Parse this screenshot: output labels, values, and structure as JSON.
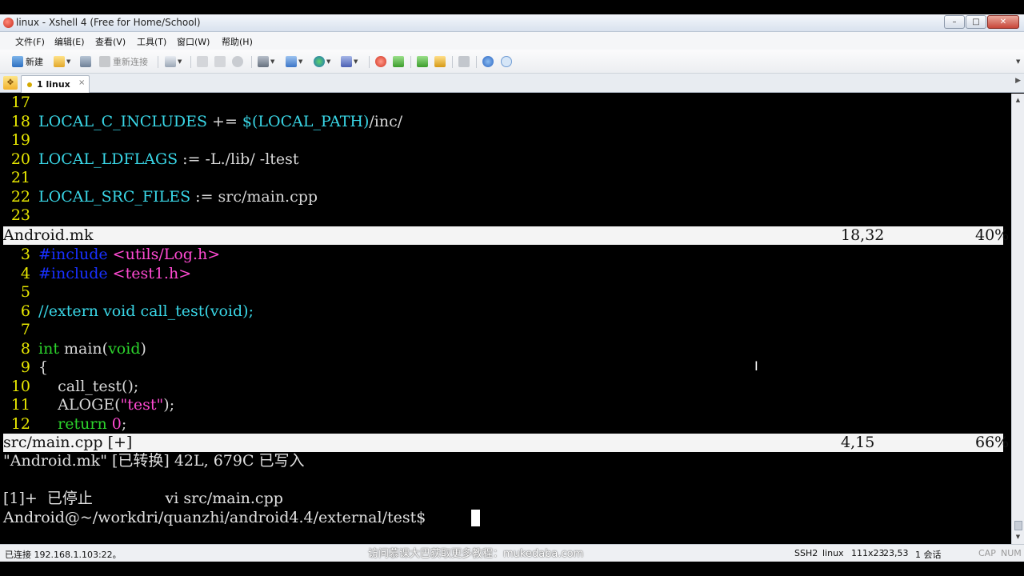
{
  "window": {
    "title": "linux - Xshell 4 (Free for Home/School)",
    "buttons": {
      "minimize": "–",
      "maximize": "□",
      "close": "✕"
    }
  },
  "menu": [
    "文件(F)",
    "编辑(E)",
    "查看(V)",
    "工具(T)",
    "窗口(W)",
    "帮助(H)"
  ],
  "toolbar": {
    "new_label": "新建",
    "reconnect_label": "重新连接"
  },
  "tabs": [
    {
      "label": "1 linux",
      "close": "×"
    }
  ],
  "terminal": {
    "upper_lines": [
      {
        "n": "17",
        "parts": []
      },
      {
        "n": "18",
        "parts": [
          {
            "t": "LOCAL_C_INCLUDES",
            "c": "cyan"
          },
          {
            "t": " += ",
            "c": "white"
          },
          {
            "t": "$(LOCAL_PATH)",
            "c": "cyan"
          },
          {
            "t": "/inc/",
            "c": "white"
          }
        ]
      },
      {
        "n": "19",
        "parts": []
      },
      {
        "n": "20",
        "parts": [
          {
            "t": "LOCAL_LDFLAGS",
            "c": "cyan"
          },
          {
            "t": " := -L./lib/ -ltest",
            "c": "white"
          }
        ]
      },
      {
        "n": "21",
        "parts": []
      },
      {
        "n": "22",
        "parts": [
          {
            "t": "LOCAL_SRC_FILES",
            "c": "cyan"
          },
          {
            "t": " := src/main.cpp",
            "c": "white"
          }
        ]
      },
      {
        "n": "23",
        "parts": []
      }
    ],
    "upper_status": {
      "file": "Android.mk",
      "pos": "18,32",
      "pct": "40%"
    },
    "lower_lines": [
      {
        "n": "3",
        "parts": [
          {
            "t": "#include",
            "c": "blue"
          },
          {
            "t": " ",
            "c": "white"
          },
          {
            "t": "<utils/Log.h>",
            "c": "mag"
          }
        ]
      },
      {
        "n": "4",
        "parts": [
          {
            "t": "#include",
            "c": "blue"
          },
          {
            "t": " ",
            "c": "white"
          },
          {
            "t": "<test1.h>",
            "c": "mag"
          }
        ]
      },
      {
        "n": "5",
        "parts": []
      },
      {
        "n": "6",
        "parts": [
          {
            "t": "//extern void call_test(void);",
            "c": "cyan"
          }
        ]
      },
      {
        "n": "7",
        "parts": []
      },
      {
        "n": "8",
        "parts": [
          {
            "t": "int",
            "c": "green"
          },
          {
            "t": " main(",
            "c": "white"
          },
          {
            "t": "void",
            "c": "green"
          },
          {
            "t": ")",
            "c": "white"
          }
        ]
      },
      {
        "n": "9",
        "parts": [
          {
            "t": "{",
            "c": "white"
          }
        ]
      },
      {
        "n": "10",
        "parts": [
          {
            "t": "    call_test();",
            "c": "white"
          }
        ]
      },
      {
        "n": "11",
        "parts": [
          {
            "t": "    ALOGE(",
            "c": "white"
          },
          {
            "t": "\"test\"",
            "c": "mag"
          },
          {
            "t": ");",
            "c": "white"
          }
        ]
      },
      {
        "n": "12",
        "parts": [
          {
            "t": "    ",
            "c": "white"
          },
          {
            "t": "return",
            "c": "green"
          },
          {
            "t": " ",
            "c": "white"
          },
          {
            "t": "0",
            "c": "mag"
          },
          {
            "t": ";",
            "c": "white"
          }
        ]
      }
    ],
    "lower_status": {
      "file": "src/main.cpp [+]",
      "pos": "4,15",
      "pct": "66%"
    },
    "message": "\"Android.mk\" [已转换] 42L, 679C 已写入",
    "job": "[1]+  已停止               vi src/main.cpp",
    "prompt": "Android@~/workdri/quanzhi/android4.4/external/test$ "
  },
  "statusbar": {
    "connection": "已连接 192.168.1.103:22。",
    "watermark": "访问慕课大巴获取更多教程：mukedaba.com",
    "protocol": "SSH2",
    "term": "linux",
    "size": "111x23",
    "cursor": "23,53",
    "sessions": "1 会话",
    "caps": "CAP",
    "num": "NUM"
  },
  "colors": {
    "cyan": "#39d6e6",
    "white": "#d8d8d8",
    "blue": "#1830ff",
    "magenta": "#ff4ad2",
    "green": "#2cd32c",
    "linenum": "#e8e800",
    "status_bg": "#f4f4f4"
  }
}
